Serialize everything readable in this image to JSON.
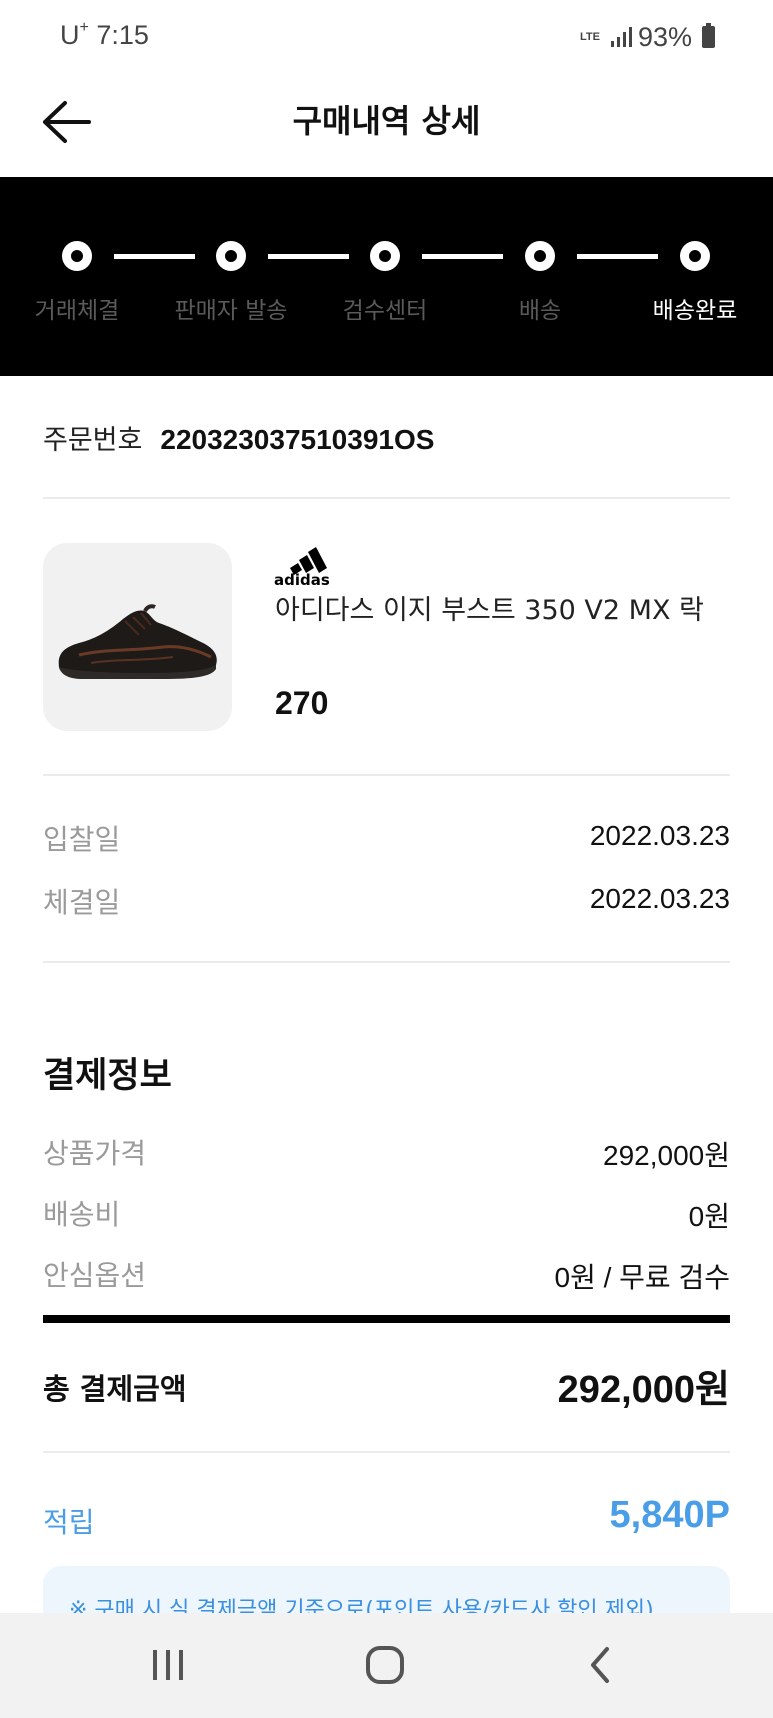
{
  "status_bar": {
    "carrier": "U",
    "carrier_mark": "+",
    "time": "7:15",
    "network": "LTE",
    "battery": "93%"
  },
  "header": {
    "title": "구매내역 상세"
  },
  "progress": {
    "steps": [
      {
        "label": "거래체결",
        "active": false
      },
      {
        "label": "판매자 발송",
        "active": false
      },
      {
        "label": "검수센터",
        "active": false
      },
      {
        "label": "배송",
        "active": false
      },
      {
        "label": "배송완료",
        "active": true
      }
    ]
  },
  "order": {
    "label": "주문번호",
    "number": "220323037510391OS"
  },
  "product": {
    "brand": "adidas",
    "name": "아디다스 이지 부스트 350 V2 MX 락",
    "size": "270"
  },
  "dates": [
    {
      "label": "입찰일",
      "value": "2022.03.23"
    },
    {
      "label": "체결일",
      "value": "2022.03.23"
    }
  ],
  "payment": {
    "title": "결제정보",
    "rows": [
      {
        "label": "상품가격",
        "value": "292,000원"
      },
      {
        "label": "배송비",
        "value": "0원"
      },
      {
        "label": "안심옵션",
        "value": "0원 / 무료 검수"
      }
    ],
    "total_label": "총 결제금액",
    "total_value": "292,000원"
  },
  "points": {
    "label": "적립",
    "value": "5,840P",
    "notice": "※  구매 시 실 결제금액 기준으로(포인트 사용/카드사 할인 제외)"
  },
  "colors": {
    "accent": "#4a9ee8",
    "progress_bg": "#000000"
  }
}
